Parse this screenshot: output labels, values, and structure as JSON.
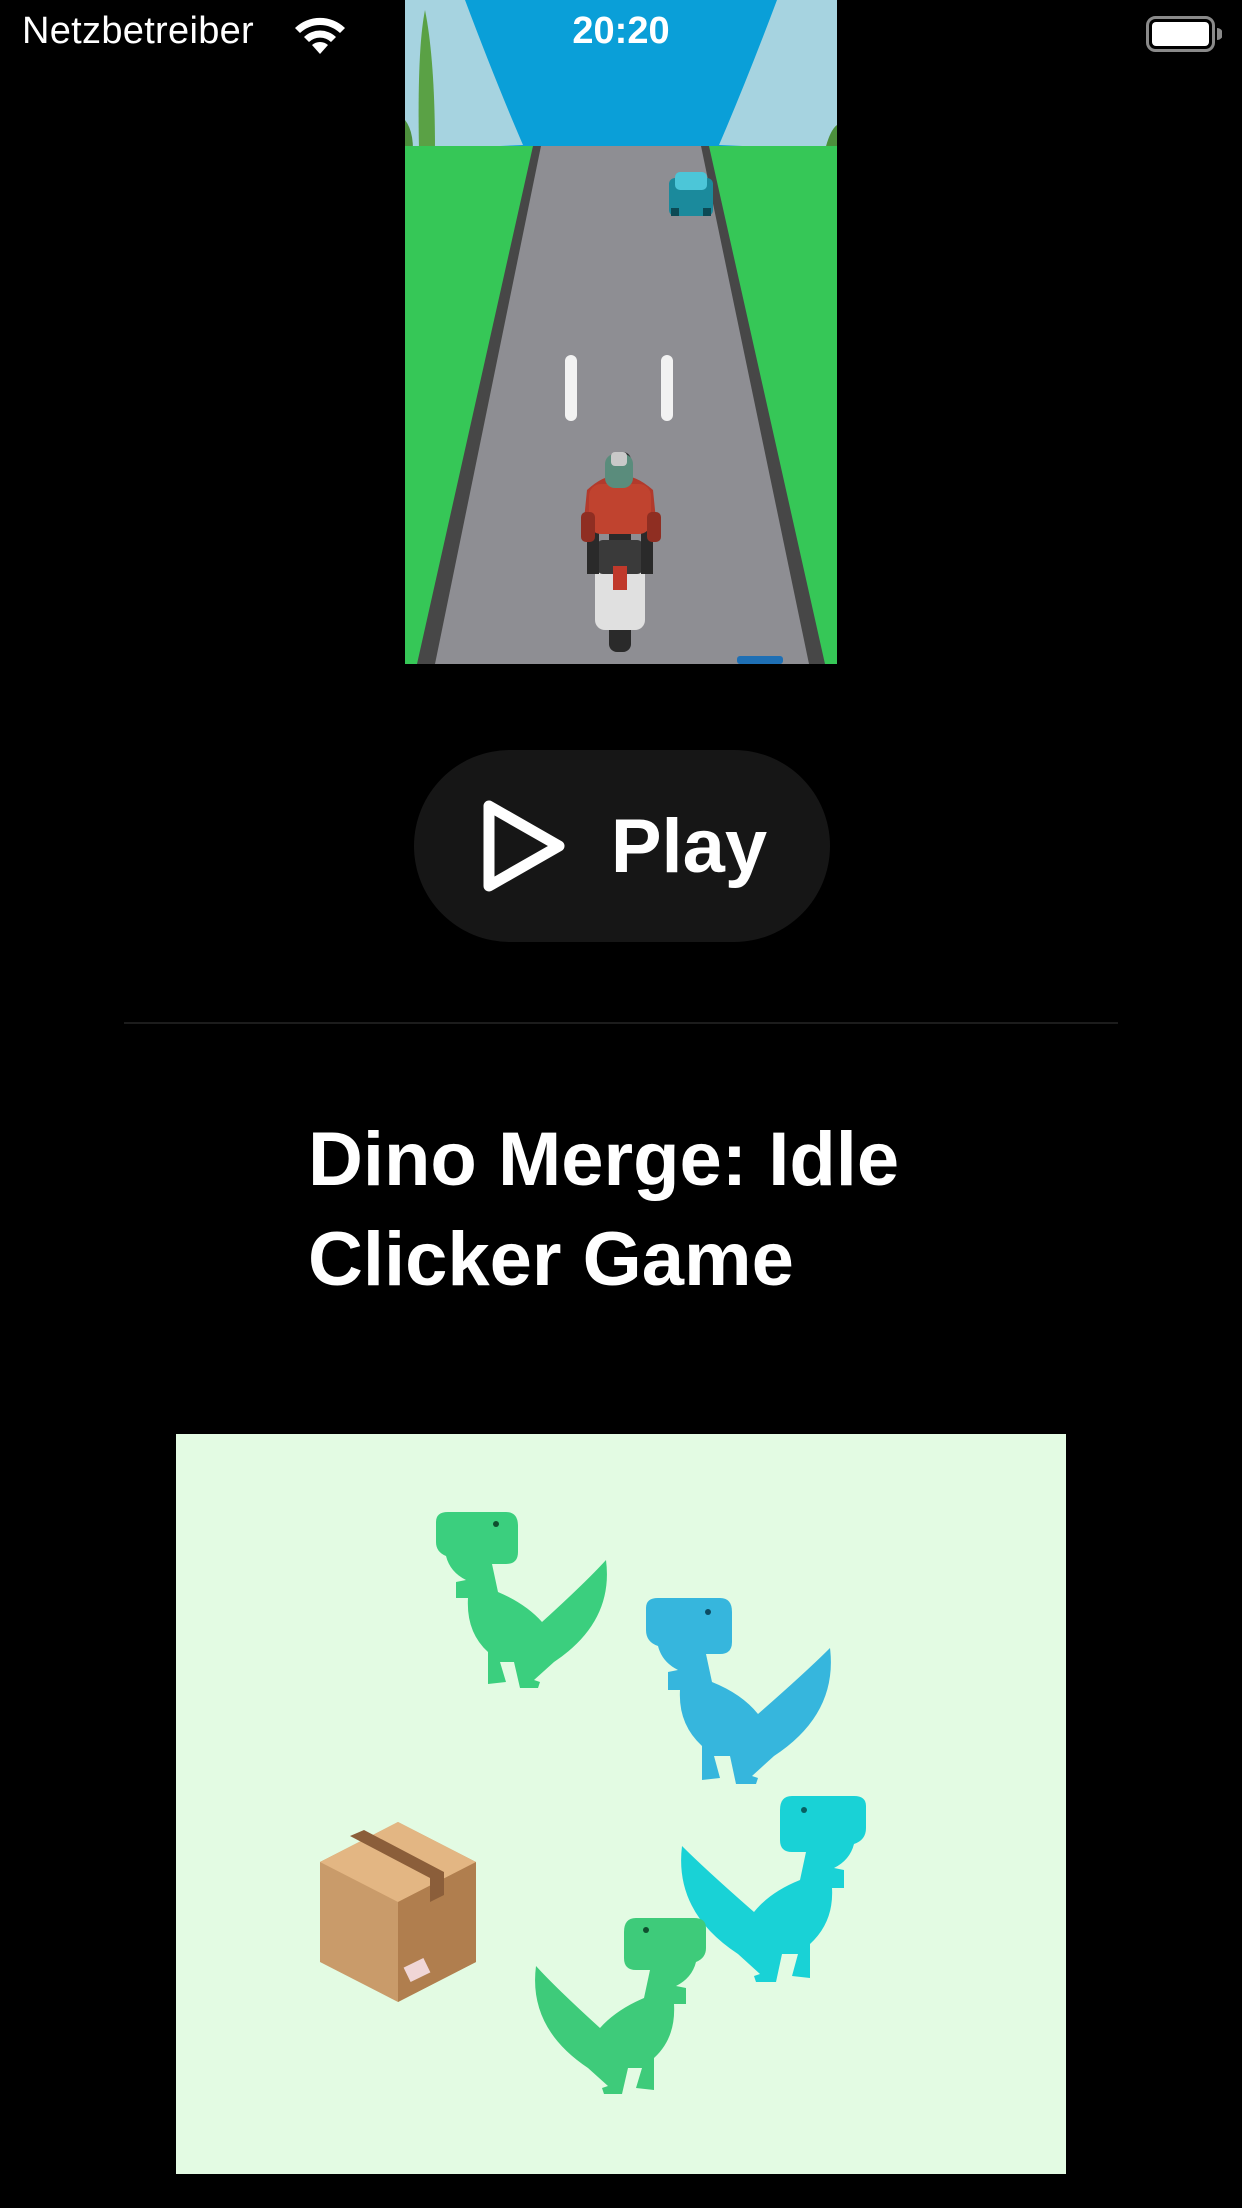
{
  "status_bar": {
    "carrier": "Netzbetreiber",
    "time": "20:20",
    "wifi_icon": "wifi-icon",
    "battery_icon": "battery-full-icon"
  },
  "featured_game": {
    "preview_alt": "motorcycle racing game preview",
    "play_label": "Play",
    "play_icon": "play-icon"
  },
  "next_game": {
    "title": "Dino Merge: Idle Clicker Game",
    "preview_alt": "dinosaurs and box illustration"
  },
  "colors": {
    "background": "#000000",
    "button_bg": "#161616",
    "grass": "#36c757",
    "road": "#8e8e93",
    "sky": "#0a9fd8",
    "dino_bg": "#e3fbe3"
  }
}
